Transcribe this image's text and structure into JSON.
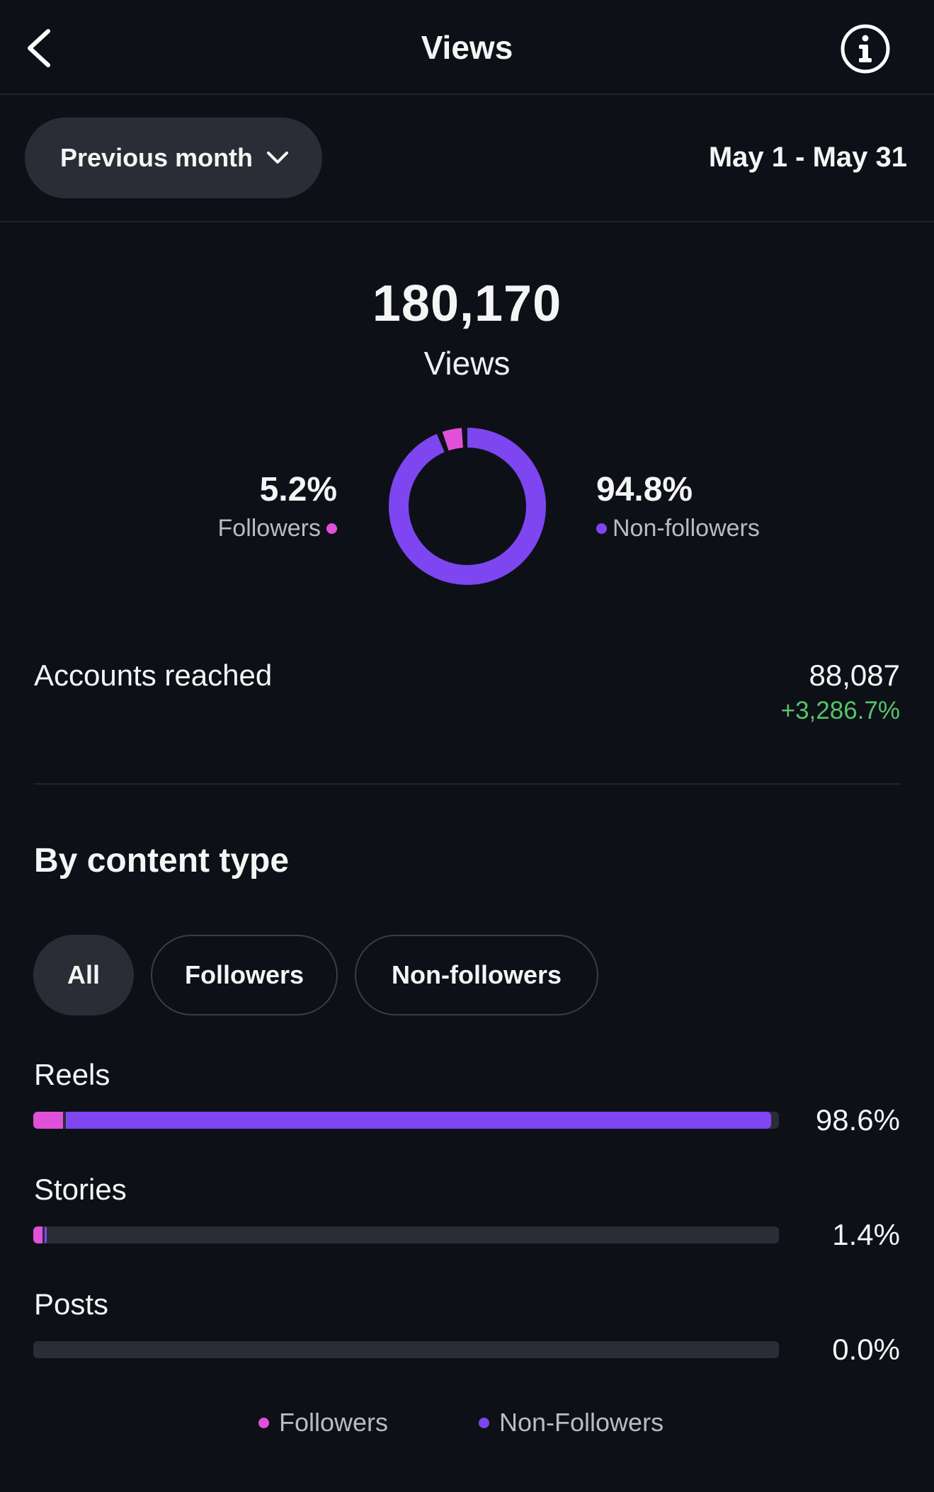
{
  "header": {
    "title": "Views",
    "back_icon": "chevron-left-icon",
    "info_icon": "info-circle-icon"
  },
  "filter": {
    "period_label": "Previous month",
    "period_icon": "chevron-down-icon",
    "date_range": "May 1 - May 31"
  },
  "total": {
    "value": "180,170",
    "label": "Views"
  },
  "split": {
    "followers": {
      "pct": "5.2%",
      "label": "Followers",
      "fraction": 0.052,
      "color": "#e150d9"
    },
    "non_followers": {
      "pct": "94.8%",
      "label": "Non-followers",
      "fraction": 0.948,
      "color": "#7d46f0"
    }
  },
  "reach": {
    "label": "Accounts reached",
    "value": "88,087",
    "change": "+3,286.7%",
    "change_color": "#56c46b"
  },
  "content": {
    "title": "By content type",
    "chips": [
      {
        "label": "All",
        "active": true
      },
      {
        "label": "Followers",
        "active": false
      },
      {
        "label": "Non-followers",
        "active": false
      }
    ],
    "rows": [
      {
        "label": "Reels",
        "pct": "98.6%",
        "followers_fraction": 0.04,
        "non_followers_fraction": 0.946
      },
      {
        "label": "Stories",
        "pct": "1.4%",
        "followers_fraction": 0.012,
        "non_followers_fraction": 0.003
      },
      {
        "label": "Posts",
        "pct": "0.0%",
        "followers_fraction": 0.0,
        "non_followers_fraction": 0.0
      }
    ]
  },
  "legend": {
    "followers": "Followers",
    "non_followers": "Non-Followers"
  }
}
